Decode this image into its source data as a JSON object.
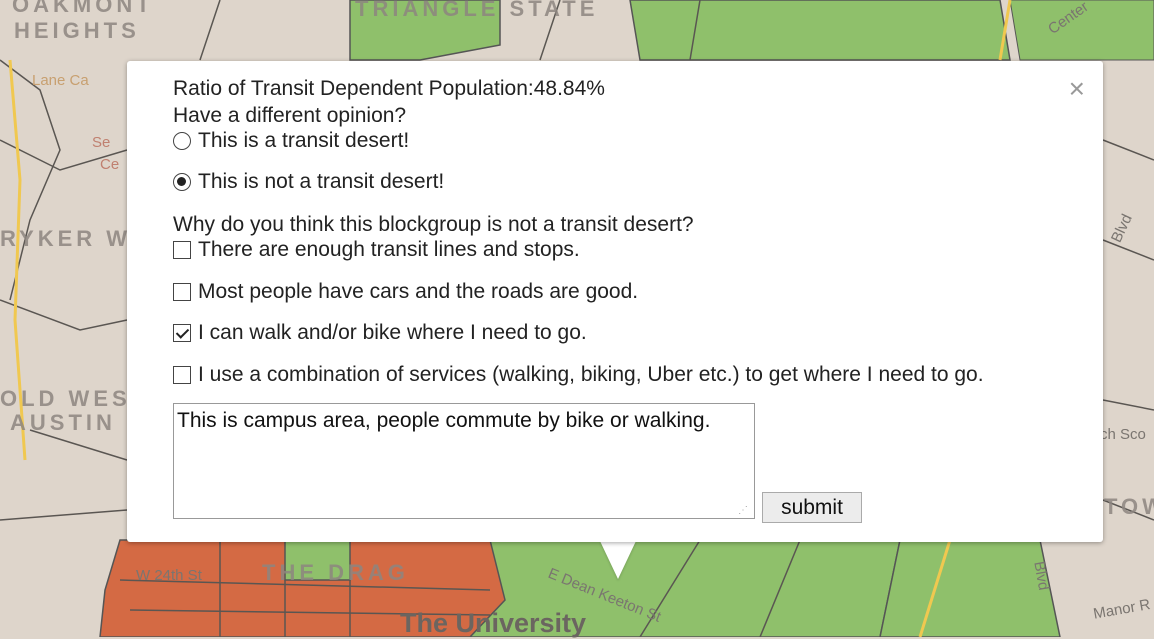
{
  "map": {
    "labels": {
      "oakmont": "OAKMONT",
      "heights": "HEIGHTS",
      "triangle_state": "TRIANGLE STATE",
      "ryker": "RYKER W",
      "old_west": "OLD WES",
      "austin": "AUSTIN",
      "the_drag": "THE DRAG",
      "w24th": "W 24th St",
      "dean_keeton": "E Dean Keeton St",
      "university": "The University",
      "lane_ca": "Lane Ca",
      "se": "Se",
      "ce": "Ce",
      "blvd": "Blvd",
      "ch_sco": "ch Sco",
      "tow": "TOW",
      "manor": "Manor R",
      "center": "Center",
      "blvd2": "Blvd"
    },
    "colors": {
      "background": "#ded5cb",
      "green_zone": "#8fc06b",
      "red_zone": "#d46a44"
    }
  },
  "popup": {
    "close_label": "×",
    "ratio_text": "Ratio of Transit Dependent Population:48.84%",
    "opinion_prompt": "Have a different opinion?",
    "radio_options": [
      {
        "label": "This is a transit desert!",
        "checked": false
      },
      {
        "label": "This is not a transit desert!",
        "checked": true
      }
    ],
    "reason_question": "Why do you think this blockgroup is not a transit desert?",
    "checkbox_options": [
      {
        "label": "There are enough transit lines and stops.",
        "checked": false
      },
      {
        "label": "Most people have cars and the roads are good.",
        "checked": false
      },
      {
        "label": "I can walk and/or bike where I need to go.",
        "checked": true
      },
      {
        "label": "I use a combination of services (walking, biking, Uber etc.) to get where I need to go.",
        "checked": false
      }
    ],
    "comment_value": "This is campus area, people commute by bike or walking.",
    "submit_label": "submit"
  }
}
